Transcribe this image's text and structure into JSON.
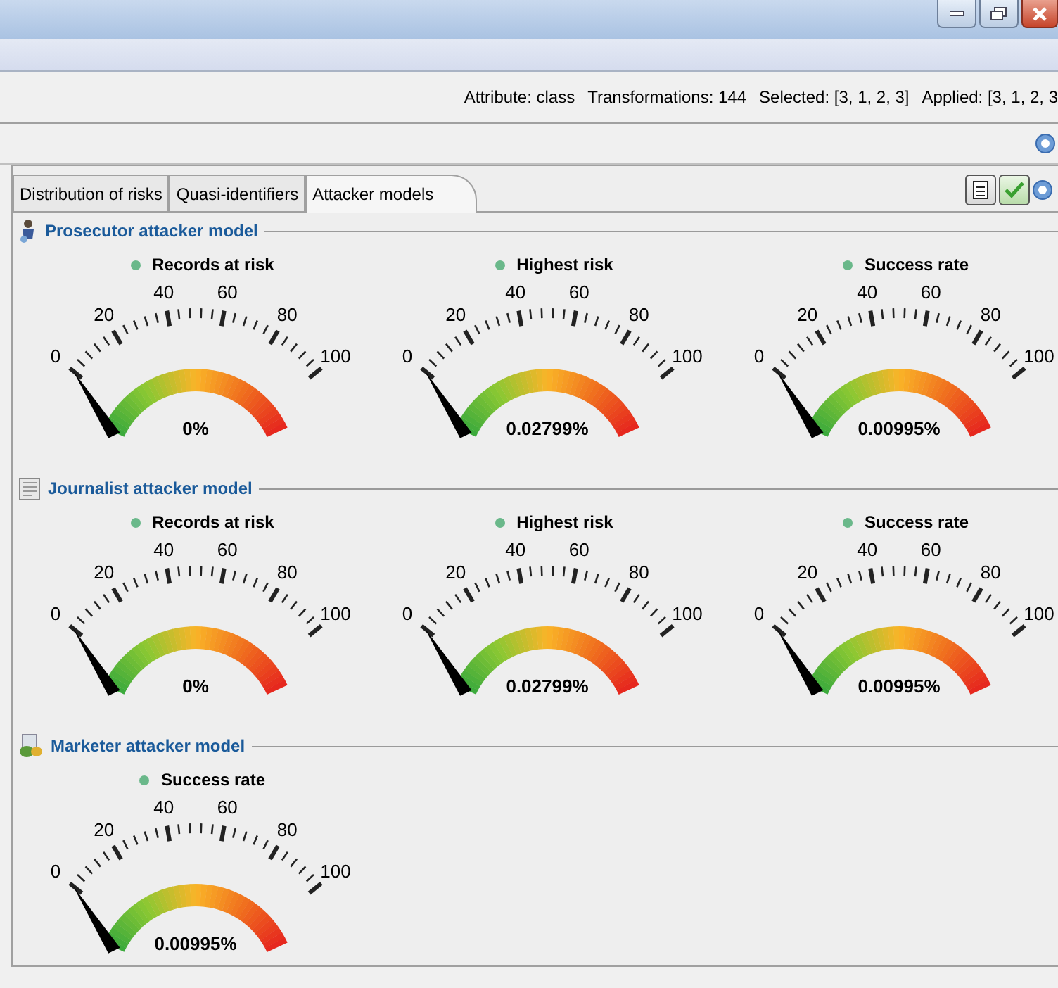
{
  "info_bar": [
    "Attribute: class",
    "Transformations: 144",
    "Selected: [3, 1, 2, 3]",
    "Applied: [3, 1, 2, 3"
  ],
  "tabs": [
    {
      "label": "Distribution of risks",
      "selected": false
    },
    {
      "label": "Quasi-identifiers",
      "selected": false
    },
    {
      "label": "Attacker models",
      "selected": true
    }
  ],
  "sections": [
    {
      "kind": "prosecutor",
      "title": "Prosecutor attacker model",
      "gauges": [
        {
          "title": "Records at risk",
          "value": "0%",
          "scale": [
            "0",
            "20",
            "40",
            "60",
            "80",
            "100"
          ]
        },
        {
          "title": "Highest risk",
          "value": "0.02799%",
          "scale": [
            "0",
            "20",
            "40",
            "60",
            "80",
            "100"
          ]
        },
        {
          "title": "Success rate",
          "value": "0.00995%",
          "scale": [
            "0",
            "20",
            "40",
            "60",
            "80",
            "100"
          ]
        }
      ]
    },
    {
      "kind": "journalist",
      "title": "Journalist attacker model",
      "gauges": [
        {
          "title": "Records at risk",
          "value": "0%",
          "scale": [
            "0",
            "20",
            "40",
            "60",
            "80",
            "100"
          ]
        },
        {
          "title": "Highest risk",
          "value": "0.02799%",
          "scale": [
            "0",
            "20",
            "40",
            "60",
            "80",
            "100"
          ]
        },
        {
          "title": "Success rate",
          "value": "0.00995%",
          "scale": [
            "0",
            "20",
            "40",
            "60",
            "80",
            "100"
          ]
        }
      ]
    },
    {
      "kind": "marketer",
      "title": "Marketer attacker model",
      "gauges": [
        {
          "title": "Success rate",
          "value": "0.00995%",
          "scale": [
            "0",
            "20",
            "40",
            "60",
            "80",
            "100"
          ]
        }
      ]
    }
  ]
}
